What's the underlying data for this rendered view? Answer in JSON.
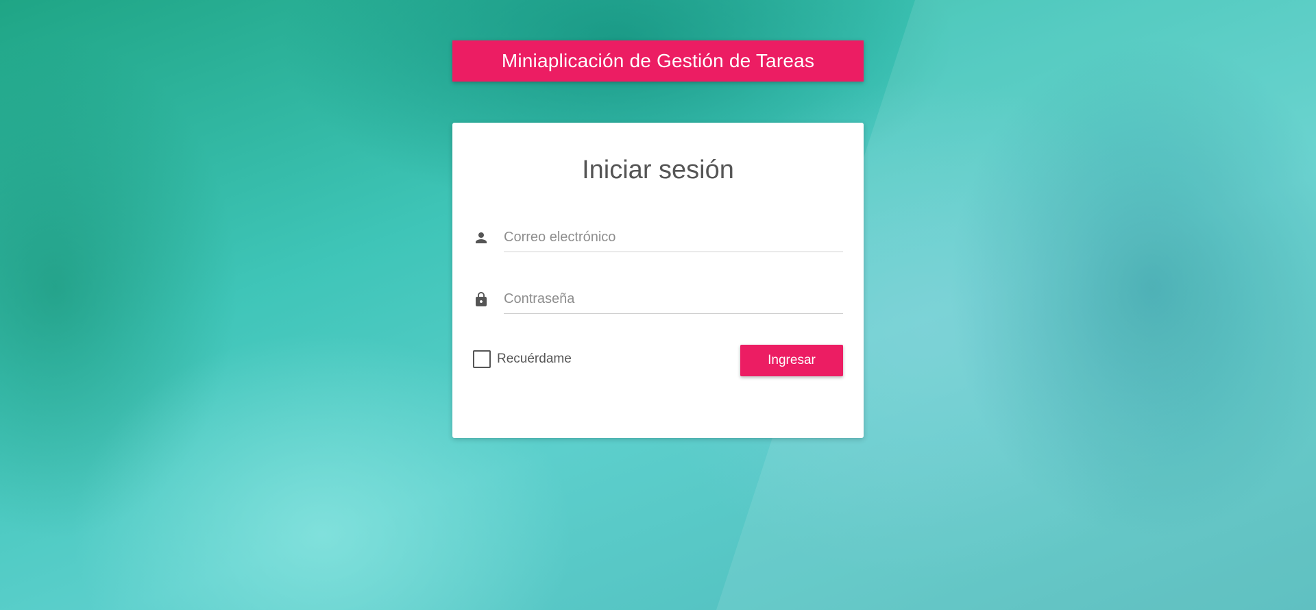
{
  "app": {
    "title": "Miniaplicación de Gestión de Tareas"
  },
  "login": {
    "title": "Iniciar sesión",
    "email": {
      "value": "",
      "placeholder": "Correo electrónico",
      "icon": "person-icon"
    },
    "password": {
      "value": "",
      "placeholder": "Contraseña",
      "icon": "lock-icon"
    },
    "remember": {
      "label": "Recuérdame",
      "checked": false
    },
    "submit_label": "Ingresar"
  },
  "colors": {
    "accent": "#ec1d63",
    "card": "#ffffff",
    "text": "#555555"
  }
}
